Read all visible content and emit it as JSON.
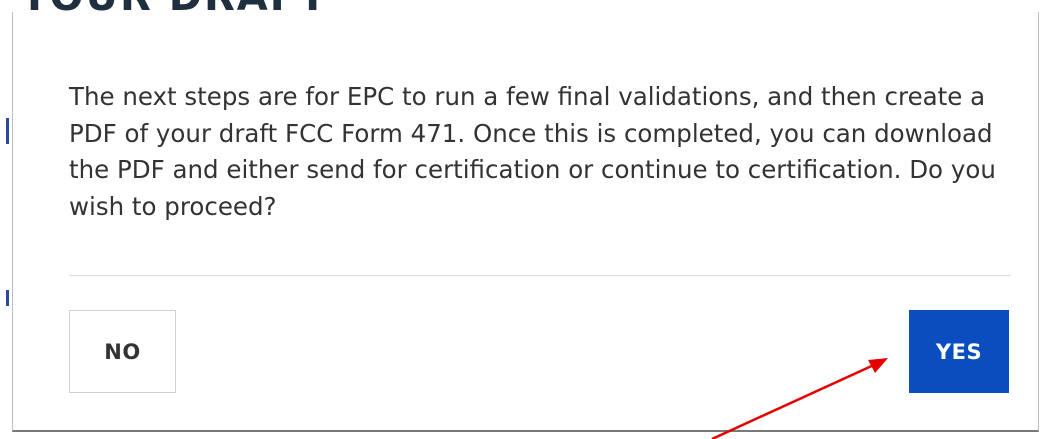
{
  "background": {
    "heading_text": "YOUR DRAFT"
  },
  "modal": {
    "message": "The next steps are for EPC to run a few final validations, and then create a PDF of your draft FCC Form 471. Once this is completed, you can download the PDF and either send for certification or continue to certification. Do you wish to proceed?",
    "no_label": "NO",
    "yes_label": "YES"
  },
  "colors": {
    "primary_button": "#0a4dbf",
    "annotation_arrow": "#e60000",
    "text": "#333333"
  },
  "icons": {
    "annotation": "red-arrow-icon"
  }
}
